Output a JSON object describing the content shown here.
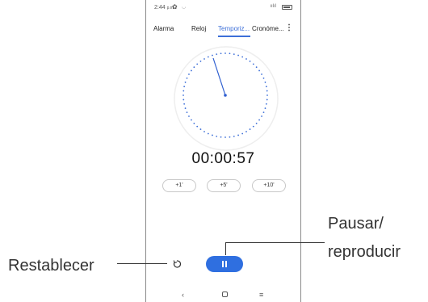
{
  "status_bar": {
    "time": "2:44",
    "ampm": "p.m.",
    "signal": "ıılıl"
  },
  "tabs": [
    {
      "label": "Alarma"
    },
    {
      "label": "Reloj"
    },
    {
      "label": "Temporiz..."
    },
    {
      "label": "Cronóme..."
    }
  ],
  "active_tab": "Temporiz...",
  "timer": {
    "display": "00:00:57"
  },
  "quick_add": [
    "+1'",
    "+5'",
    "+10'"
  ],
  "annotations": {
    "reset": "Restablecer",
    "pause_line1": "Pausar/",
    "pause_line2": "reproducir"
  },
  "colors": {
    "accent": "#2f6fe0",
    "tab_active": "#3d6fd8"
  },
  "icons": [
    "settings-icon",
    "more-vert-icon",
    "reset-icon",
    "pause-icon",
    "back-icon",
    "home-icon",
    "recent-apps-icon"
  ]
}
